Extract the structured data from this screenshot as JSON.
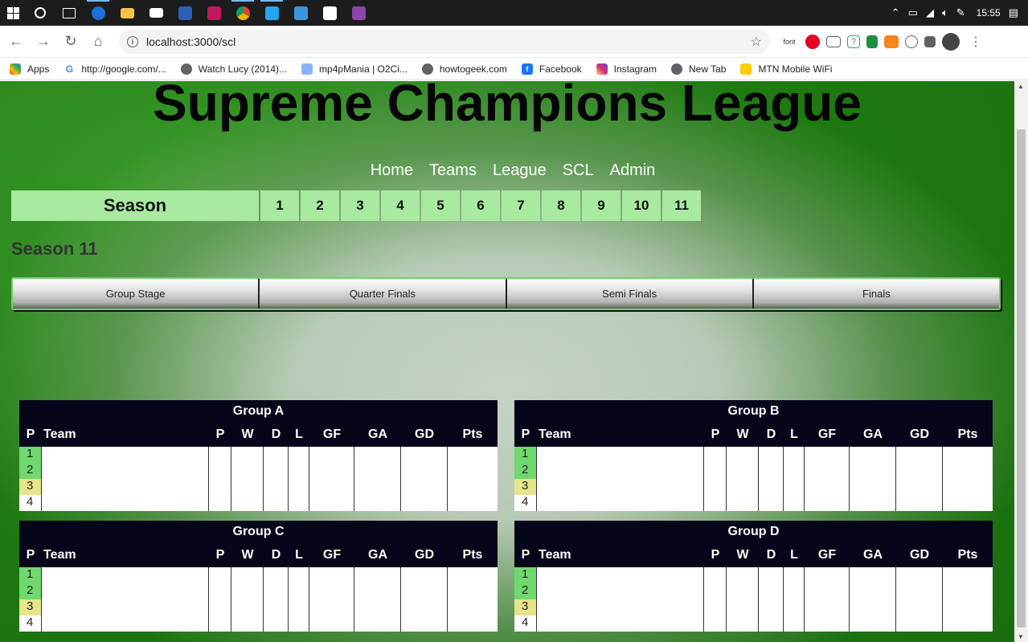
{
  "taskbar": {
    "clock": "15:55",
    "active_window_title": "Supreme Champions League"
  },
  "browser": {
    "url": "localhost:3000/scl",
    "bookmarks": [
      {
        "label": "Apps",
        "icon": "apps-grid-icon"
      },
      {
        "label": "http://google.com/...",
        "icon": "google-icon"
      },
      {
        "label": "Watch Lucy (2014)...",
        "icon": "globe-icon"
      },
      {
        "label": "mp4pMania | O2Ci...",
        "icon": "mp4pmania-icon"
      },
      {
        "label": "howtogeek.com",
        "icon": "globe-icon"
      },
      {
        "label": "Facebook",
        "icon": "facebook-icon"
      },
      {
        "label": "Instagram",
        "icon": "instagram-icon"
      },
      {
        "label": "New Tab",
        "icon": "globe-icon"
      },
      {
        "label": "MTN Mobile WiFi",
        "icon": "mtn-icon"
      }
    ],
    "extension_label": "font"
  },
  "site": {
    "title": "Supreme Champions League",
    "nav": [
      "Home",
      "Teams",
      "League",
      "SCL",
      "Admin"
    ],
    "season_label": "Season",
    "seasons": [
      "1",
      "2",
      "3",
      "4",
      "5",
      "6",
      "7",
      "8",
      "9",
      "10",
      "11"
    ],
    "current_season": "Season 11",
    "stages": [
      "Group Stage",
      "Quarter Finals",
      "Semi Finals",
      "Finals"
    ]
  },
  "table_columns": [
    "P",
    "Team",
    "P",
    "W",
    "D",
    "L",
    "GF",
    "GA",
    "GD",
    "Pts"
  ],
  "groups": [
    {
      "name": "Group A",
      "positions": [
        "1",
        "2",
        "3",
        "4"
      ]
    },
    {
      "name": "Group B",
      "positions": [
        "1",
        "2",
        "3",
        "4"
      ]
    },
    {
      "name": "Group C",
      "positions": [
        "1",
        "2",
        "3",
        "4"
      ]
    },
    {
      "name": "Group D",
      "positions": [
        "1",
        "2",
        "3",
        "4"
      ]
    }
  ],
  "colors": {
    "qualify": "#6fd86e",
    "playoff": "#e8e48a",
    "season_button": "#a8eaa0",
    "table_header": "#06061a"
  }
}
